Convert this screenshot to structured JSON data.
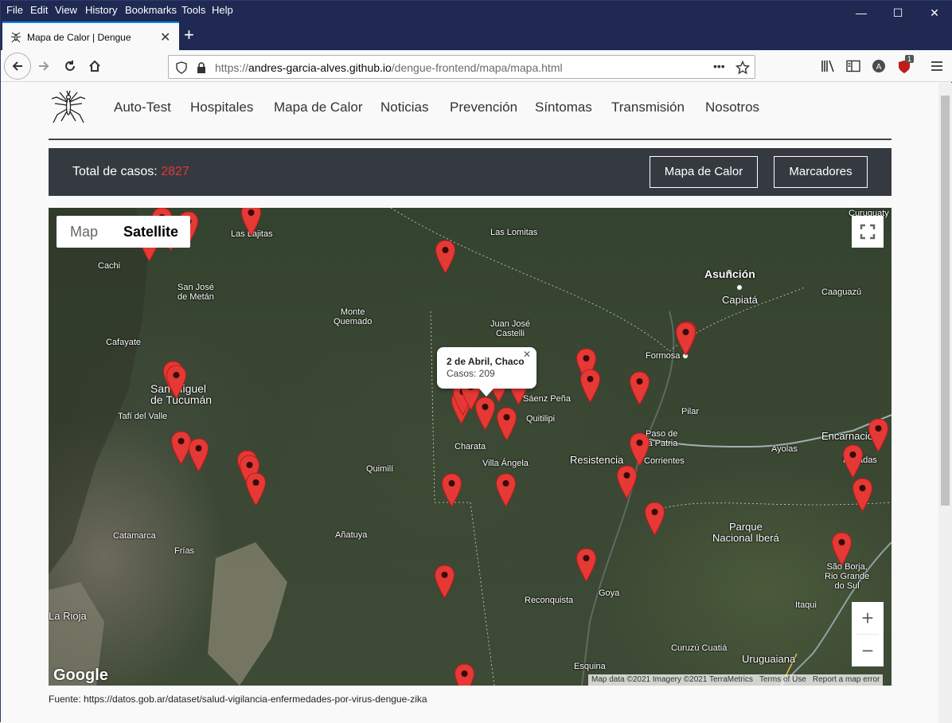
{
  "browser": {
    "menu": [
      "File",
      "Edit",
      "View",
      "History",
      "Bookmarks",
      "Tools",
      "Help"
    ],
    "window_controls": {
      "minimize": "—",
      "maximize": "☐",
      "close": "✕"
    },
    "tab": {
      "title": "Mapa de Calor | Dengue",
      "close": "✕"
    },
    "new_tab": "+",
    "url": {
      "prefix": "https://",
      "host": "andres-garcia-alves.github.io",
      "path": "/dengue-frontend/mapa/mapa.html"
    },
    "page_actions": "•••",
    "extension_badge": "1"
  },
  "site": {
    "nav": [
      "Auto-Test",
      "Hospitales",
      "Mapa de Calor",
      "Noticias",
      "Prevención",
      "Síntomas",
      "Transmisión",
      "Nosotros"
    ],
    "total_label": "Total de casos:",
    "total_value": "2827",
    "buttons": {
      "heatmap": "Mapa de Calor",
      "markers": "Marcadores"
    },
    "source": "Fuente: https://datos.gob.ar/dataset/salud-vigilancia-enfermedades-por-virus-dengue-zika"
  },
  "map": {
    "type_map": "Map",
    "type_satellite": "Satellite",
    "info_window": {
      "title": "2 de Abril, Chaco",
      "cases": "Casos: 209"
    },
    "zoom_in": "+",
    "zoom_out": "−",
    "google": "Google",
    "attribution": [
      "Map data ©2021 Imagery ©2021 TerraMetrics",
      "Terms of Use",
      "Report a map error"
    ],
    "labels": {
      "curuguaty": "Curuguaty",
      "las_lomitas": "Las Lomitas",
      "las_lajitas": "Las Lajitas",
      "cachi": "Cachi",
      "san_jose": "San José\nde Metán",
      "asuncion": "Asunción",
      "capiata": "Capiatá",
      "caaguazu": "Caaguazú",
      "monte_quemado": "Monte\nQuemado",
      "juan_jose": "Juan José\nCastelli",
      "cafayate": "Cafayate",
      "formosa": "Formosa",
      "tucuman": "San Miguel\nde Tucumán",
      "saenz_pena": "Sáenz Peña",
      "tafi": "Tafí del Valle",
      "quitilipi": "Quitilipi",
      "pilar": "Pilar",
      "charata": "Charata",
      "encarnacion": "Encarnación",
      "paso_patria": "Paso de\nla Patria",
      "ayolas": "Ayolas",
      "posadas": "Posadas",
      "resistencia": "Resistencia",
      "corrientes": "Corrientes",
      "quimili": "Quimilí",
      "villa_angela": "Villa Ángela",
      "catamarca": "Catamarca",
      "anatuya": "Añatuya",
      "parque": "Parque\nNacional Iberá",
      "frias": "Frías",
      "sao_borja": "São Borja,\nRio Grande\ndo Sul",
      "reconquista": "Reconquista",
      "goya": "Goya",
      "la_rioja": "La Rioja",
      "itaqui": "Itaqui",
      "curuzu": "Curuzú Cuatiá",
      "esquina": "Esquina",
      "uruguaiana": "Uruguaiana"
    }
  },
  "colors": {
    "accent": "#e53935",
    "dark_panel": "#343a40",
    "browser_chrome": "#1f2952"
  }
}
